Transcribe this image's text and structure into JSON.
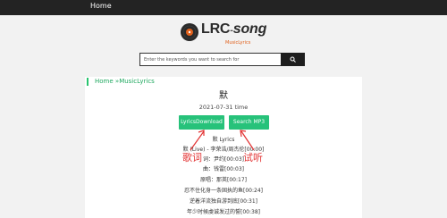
{
  "nav": {
    "home": "Home"
  },
  "logo": {
    "main": "LRC",
    "song": "song",
    "sub": "MusicLyrics"
  },
  "search": {
    "placeholder": "Enter the keywords you want to search for"
  },
  "breadcrumb": {
    "home": "Home",
    "sep": " »",
    "section": "MusicLyrics"
  },
  "song": {
    "title": "默",
    "date": "2021-07-31 time"
  },
  "buttons": {
    "lyrics": "LyricsDownload",
    "mp3": "Search MP3"
  },
  "lyrics": [
    "默 Lyrics",
    "默 (Live) - 李荣浩/周杰伦[00:00]",
    "词：尹约[00:03]",
    "曲：钱雷[00:03]",
    "原唱：那英[00:17]",
    "忍不住化身一条固执的鱼[00:24]",
    "逆着洋流独自游到底[00:31]",
    "年少时候虔诚发过的誓[00:38]"
  ],
  "annotations": {
    "left": "歌词",
    "right": "试听"
  },
  "colors": {
    "accent_green": "#27c27a",
    "annotation_red": "#e23131",
    "logo_orange": "#e0601b"
  }
}
